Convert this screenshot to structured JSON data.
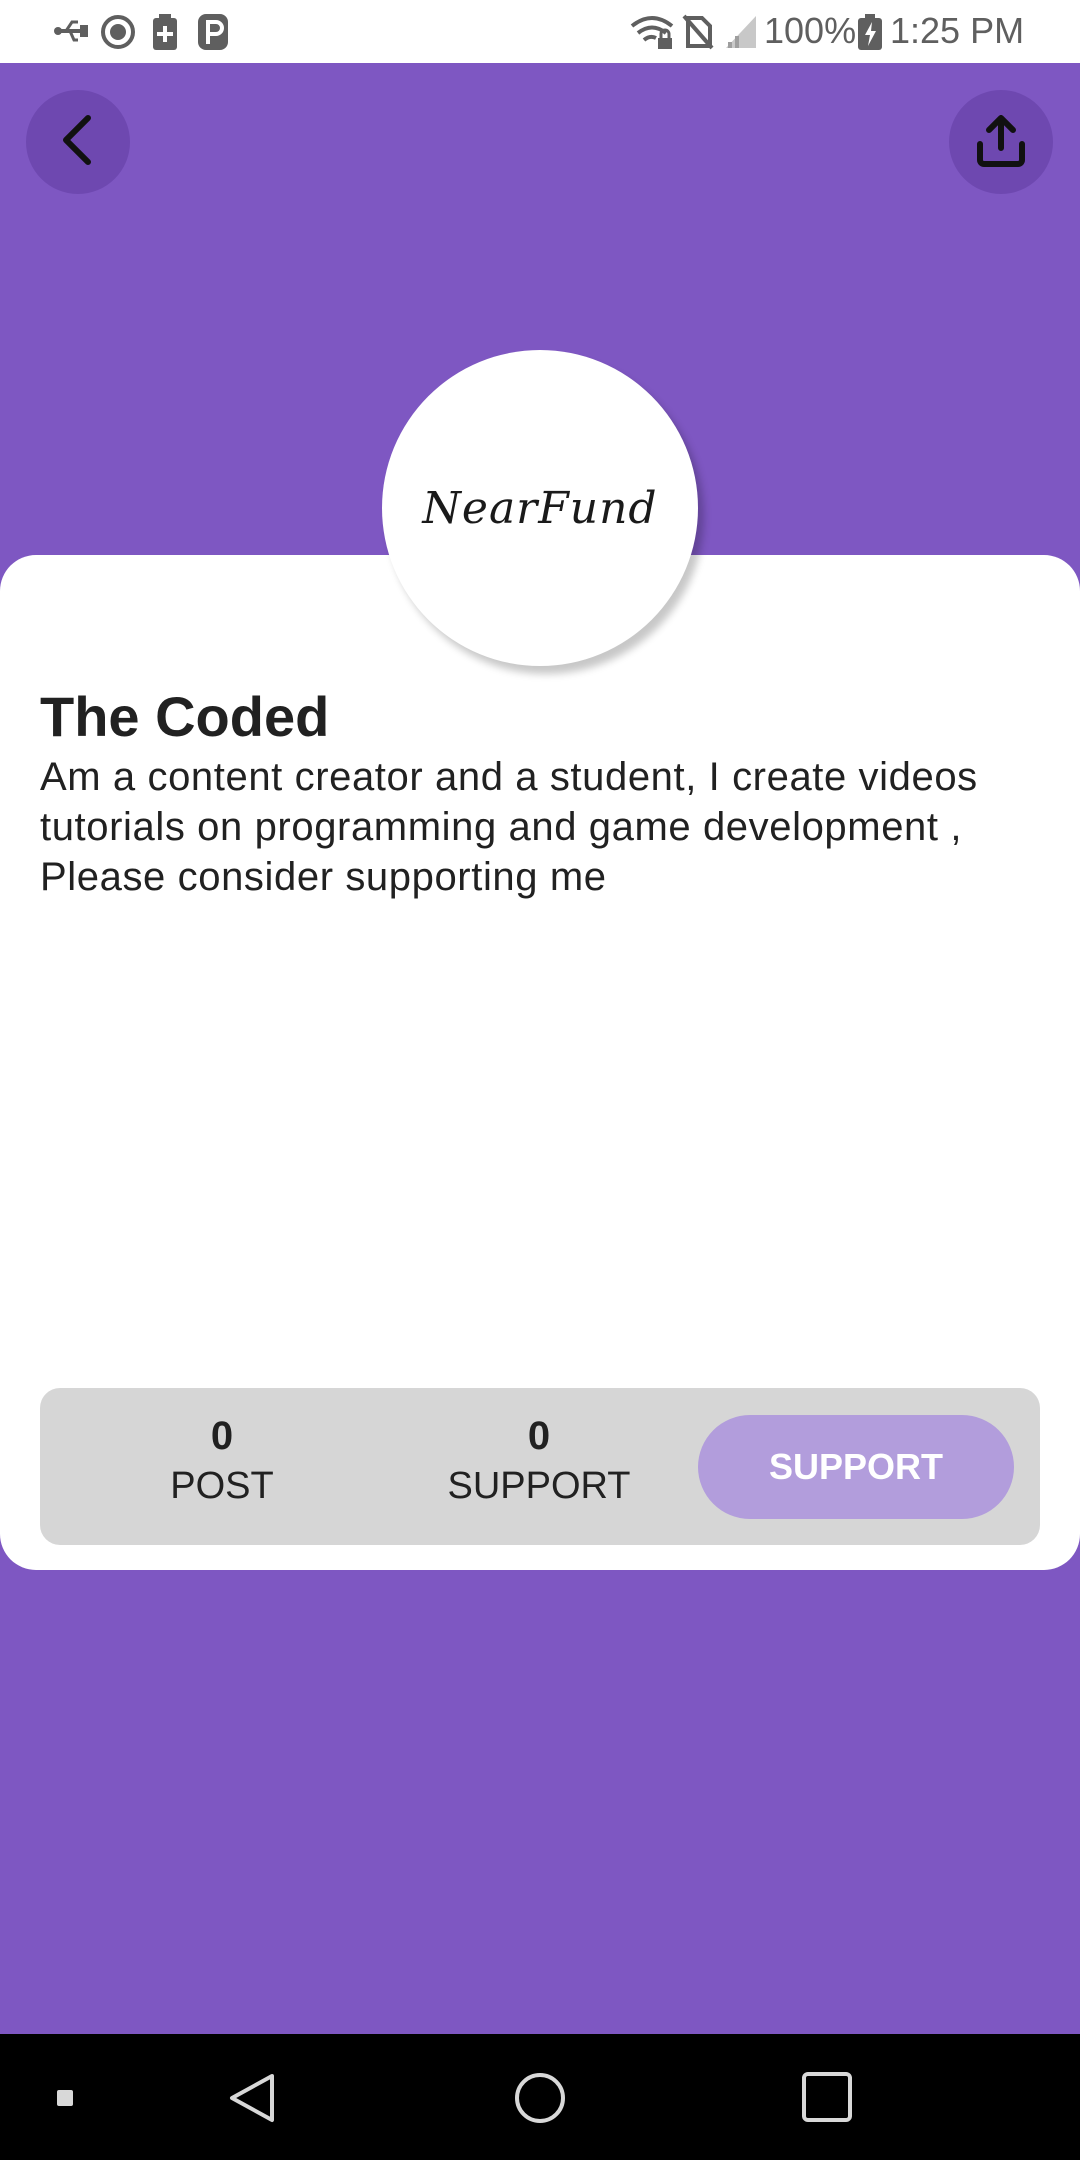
{
  "status_bar": {
    "battery": "100%",
    "time": "1:25 PM",
    "left_icons": [
      "usb-icon",
      "android-debug-icon",
      "battery-saver-icon",
      "parking-icon"
    ],
    "right_icons": [
      "wifi-lock-icon",
      "no-sim-icon",
      "signal-icon",
      "battery-charging-icon"
    ]
  },
  "header": {
    "back_icon": "chevron-left-icon",
    "share_icon": "share-upload-icon"
  },
  "profile": {
    "avatar_text": "NearFund",
    "name": "The Coded",
    "bio": "Am a content creator and a student, I create videos tutorials on programming and game development , Please consider supporting me"
  },
  "stats": {
    "post_value": "0",
    "post_label": "POST",
    "support_value": "0",
    "support_label": "SUPPORT",
    "support_button": "SUPPORT"
  },
  "colors": {
    "background": "#7E57C2",
    "header_button": "#6E48B0",
    "stats_bar": "#D6D6D6",
    "support_button": "#B29DDC"
  },
  "nav_bar": {
    "icons": [
      "recents-dot-icon",
      "back-triangle-icon",
      "home-circle-icon",
      "overview-square-icon"
    ]
  }
}
